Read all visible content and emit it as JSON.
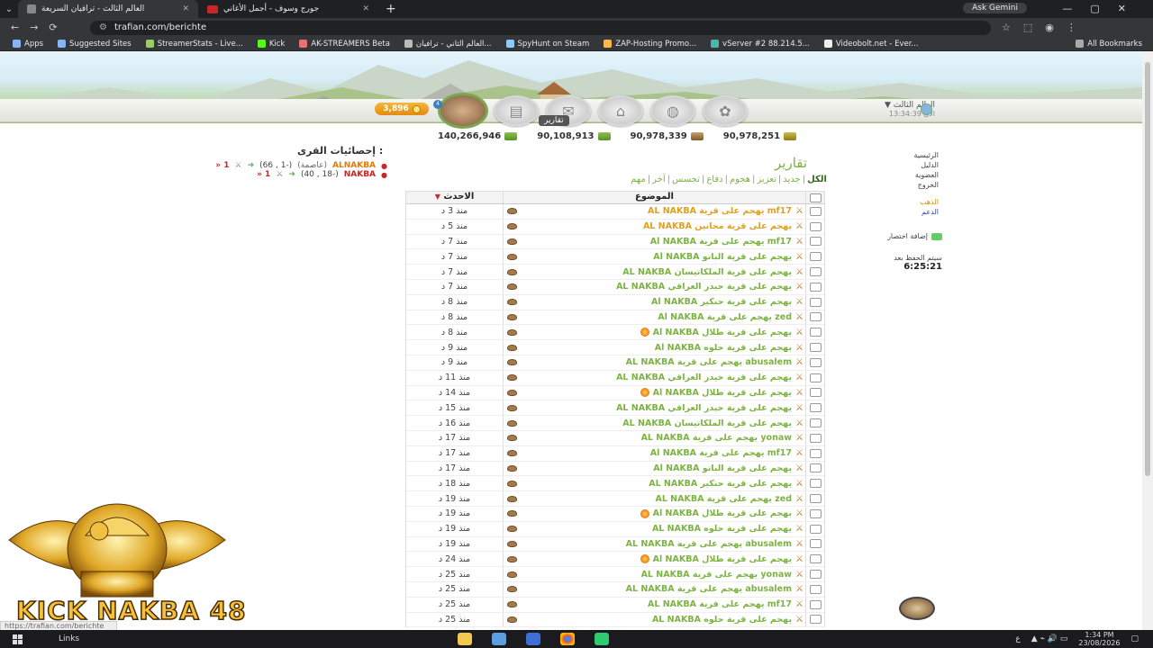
{
  "browser": {
    "tabs": [
      {
        "title": "العالم الثالث - ترافيان السريعة",
        "active": true
      },
      {
        "title": "جورج وسوف - أجمل الأغاني",
        "active": false
      }
    ],
    "ask_gemini": "Ask Gemini",
    "url": "trafian.com/berichte",
    "bookmarks": [
      "Apps",
      "Suggested Sites",
      "StreamerStats - Live...",
      "Kick",
      "AK-STREAMERS Beta",
      "العالم الثاني - ترافيان...",
      "SpyHunt on Steam",
      "ZAP-Hosting Promo...",
      "vServer #2 88.214.5...",
      "Videobolt.net - Ever..."
    ],
    "all_bookmarks": "All Bookmarks"
  },
  "game": {
    "gold": "3,896",
    "hero_level": "4",
    "tooltip": "تقارير",
    "world_name": "العالم الثالث",
    "server_time": "الآن 13:34:39",
    "resources": [
      "140,266,946",
      "90,108,913",
      "90,978,339",
      "90,978,251"
    ]
  },
  "sidebar": {
    "menu": [
      "الرئيسية",
      "الدليل",
      "العضوية",
      "الخروج"
    ],
    "gold_link": "الذهب",
    "plus_link": "الدعم",
    "shortcut": "إضافة اختصار",
    "save_label": "سيتم الحفظ بعد",
    "save_time": "6:25:21"
  },
  "village_stats": {
    "title": "إحصائيات القرى :",
    "villages": [
      {
        "name": "ALNAKBA",
        "capital": "(عاصمة)",
        "coords": "(-1 , 66)",
        "count": "1 «",
        "is_capital": true
      },
      {
        "name": "NAKBA",
        "capital": "",
        "coords": "(-18 , 40)",
        "count": "1 «",
        "is_capital": false
      }
    ]
  },
  "reports": {
    "title": "تقارير",
    "filters": [
      "الكل",
      "جديد",
      "تعزيز",
      "هجوم",
      "دفاع",
      "تجسس",
      "آخر",
      "مهم"
    ],
    "columns": {
      "subject": "الموضوع",
      "date": "الاحدث"
    },
    "rows": [
      {
        "subject": "AL NAKBA يهجم على قرية mf17",
        "date": "منذ 3 د",
        "color": "orange",
        "fire": false
      },
      {
        "subject": "AL NAKBA يهجم على قرية مجانين",
        "date": "منذ 5 د",
        "color": "orange",
        "fire": false
      },
      {
        "subject": "Al NAKBA يهجم على قرية mf17",
        "date": "منذ 7 د",
        "color": "green",
        "fire": false
      },
      {
        "subject": "Al NAKBA يهجم على قرية الباتو",
        "date": "منذ 7 د",
        "color": "green",
        "fire": false
      },
      {
        "subject": "AL NAKBA يهجم على قرية الملكاتيسان",
        "date": "منذ 7 د",
        "color": "green",
        "fire": false
      },
      {
        "subject": "AL NAKBA يهجم على قرية حيدر العراقي",
        "date": "منذ 7 د",
        "color": "green",
        "fire": false
      },
      {
        "subject": "Al NAKBA يهجم على قرية حنكير",
        "date": "منذ 8 د",
        "color": "green",
        "fire": false
      },
      {
        "subject": "Al NAKBA يهجم على قرية zed",
        "date": "منذ 8 د",
        "color": "green",
        "fire": false
      },
      {
        "subject": "Al NAKBA يهجم على قرية طلال",
        "date": "منذ 8 د",
        "color": "green",
        "fire": true
      },
      {
        "subject": "Al NAKBA يهجم على قرية حلوه",
        "date": "منذ 9 د",
        "color": "green",
        "fire": false
      },
      {
        "subject": "AL NAKBA يهجم على قرية abusalem",
        "date": "منذ 9 د",
        "color": "green",
        "fire": false
      },
      {
        "subject": "AL NAKBA يهجم على قرية حيدر العراقي",
        "date": "منذ 11 د",
        "color": "green",
        "fire": false
      },
      {
        "subject": "Al NAKBA يهجم على قرية طلال",
        "date": "منذ 14 د",
        "color": "green",
        "fire": true
      },
      {
        "subject": "AL NAKBA يهجم على قرية حيدر العراقي",
        "date": "منذ 15 د",
        "color": "green",
        "fire": false
      },
      {
        "subject": "AL NAKBA يهجم على قرية الملكاتيسان",
        "date": "منذ 16 د",
        "color": "green",
        "fire": false
      },
      {
        "subject": "AL NAKBA يهجم على قرية yonaw",
        "date": "منذ 17 د",
        "color": "green",
        "fire": false
      },
      {
        "subject": "Al NAKBA يهجم على قرية mf17",
        "date": "منذ 17 د",
        "color": "green",
        "fire": false
      },
      {
        "subject": "Al NAKBA يهجم على قرية الباتو",
        "date": "منذ 17 د",
        "color": "green",
        "fire": false
      },
      {
        "subject": "AL NAKBA يهجم على قرية حنكير",
        "date": "منذ 18 د",
        "color": "green",
        "fire": false
      },
      {
        "subject": "AL NAKBA يهجم على قرية zed",
        "date": "منذ 19 د",
        "color": "green",
        "fire": false
      },
      {
        "subject": "Al NAKBA يهجم على قرية طلال",
        "date": "منذ 19 د",
        "color": "green",
        "fire": true
      },
      {
        "subject": "AL NAKBA يهجم على قرية حلوه",
        "date": "منذ 19 د",
        "color": "green",
        "fire": false
      },
      {
        "subject": "AL NAKBA يهجم على قرية abusalem",
        "date": "منذ 19 د",
        "color": "green",
        "fire": false
      },
      {
        "subject": "Al NAKBA يهجم على قرية طلال",
        "date": "منذ 24 د",
        "color": "green",
        "fire": true
      },
      {
        "subject": "AL NAKBA يهجم على قرية yonaw",
        "date": "منذ 25 د",
        "color": "green",
        "fire": false
      },
      {
        "subject": "AL NAKBA يهجم على قرية abusalem",
        "date": "منذ 25 د",
        "color": "green",
        "fire": false
      },
      {
        "subject": "AL NAKBA يهجم على قرية mf17",
        "date": "منذ 25 د",
        "color": "green",
        "fire": false
      },
      {
        "subject": "AL NAKBA يهجم على قرية حلوه",
        "date": "منذ 25 د",
        "color": "green",
        "fire": false
      }
    ]
  },
  "overlay": {
    "logo_text": "KICK NAKBA 48"
  },
  "status_url": "https://trafian.com/berichte",
  "taskbar": {
    "search": "Links",
    "lang": "ع",
    "time": "1:34 PM",
    "date": "23/08/2026"
  },
  "colors": {
    "accent_green": "#7cb342",
    "orange": "#e0a020",
    "red": "#c62828"
  }
}
